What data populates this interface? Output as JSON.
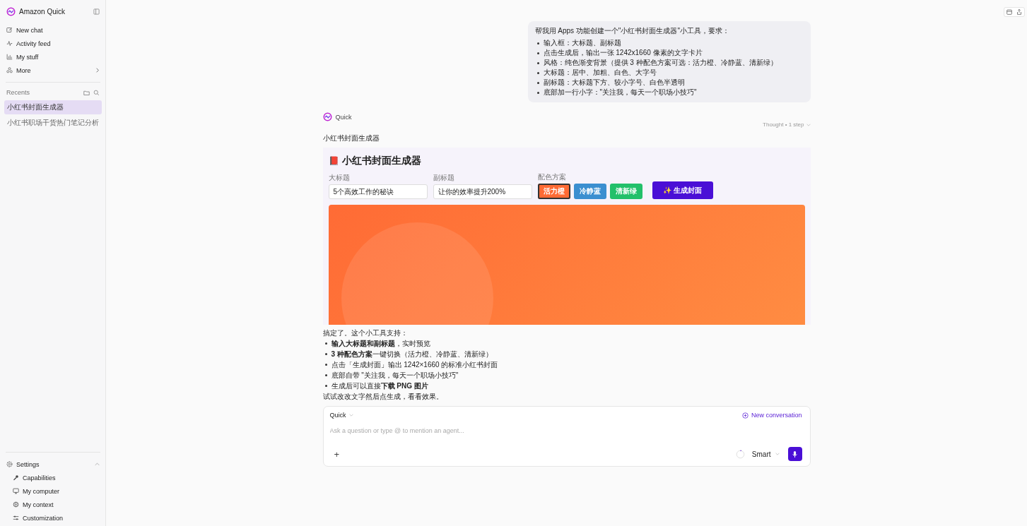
{
  "sidebar": {
    "brand": "Amazon Quick",
    "nav": [
      {
        "label": "New chat"
      },
      {
        "label": "Activity feed"
      },
      {
        "label": "My stuff"
      },
      {
        "label": "More"
      }
    ],
    "recents_label": "Recents",
    "recents": [
      {
        "label": "小红书封面生成器",
        "selected": true
      },
      {
        "label": "小红书职场干货热门笔记分析",
        "selected": false
      }
    ],
    "settings": {
      "label": "Settings",
      "expanded": true,
      "items": [
        {
          "label": "Capabilities"
        },
        {
          "label": "My computer"
        },
        {
          "label": "My context"
        },
        {
          "label": "Customization"
        }
      ]
    }
  },
  "user_message": {
    "intro": "帮我用 Apps 功能创建一个\"小红书封面生成器\"小工具，要求：",
    "bullets": [
      "输入框：大标题、副标题",
      "点击生成后，输出一张 1242x1660 像素的文字卡片",
      "风格：纯色渐变背景（提供 3 种配色方案可选：活力橙、冷静蓝、清新绿）",
      "大标题：居中、加粗、白色、大字号",
      "副标题：大标题下方、较小字号、白色半透明",
      "底部加一行小字：\"关注我，每天一个职场小技巧\""
    ]
  },
  "assistant": {
    "name": "Quick",
    "thought": "Thought • 1 step",
    "app_label": "小红书封面生成器",
    "app": {
      "icon": "📕",
      "title": "小红书封面生成器",
      "fields": [
        {
          "label": "大标题",
          "value": "5个高效工作的秘诀"
        },
        {
          "label": "副标题",
          "value": "让你的效率提升200%"
        }
      ],
      "scheme_label": "配色方案",
      "schemes": [
        {
          "label": "活力橙",
          "color": "#ff6b35",
          "selected": true
        },
        {
          "label": "冷静蓝",
          "color": "#3b8fd0",
          "selected": false
        },
        {
          "label": "清新绿",
          "color": "#22c06a",
          "selected": false
        }
      ],
      "generate": "✨ 生成封面"
    },
    "reply_intro": "搞定了。这个小工具支持：",
    "reply_bullets": [
      "**输入大标题和副标题**，实时预览",
      "**3 种配色方案**一键切换（活力橙、冷静蓝、清新绿）",
      "点击「生成封面」输出 1242×1660 的标准小红书封面",
      "底部自带 \"关注我，每天一个职场小技巧\"",
      "生成后可以直接**下载 PNG 图片**"
    ],
    "reply_outro": "试试改改文字然后点生成，看看效果。"
  },
  "composer": {
    "agent": "Quick",
    "new_conversation": "New conversation",
    "placeholder": "Ask a question or type @ to mention an agent...",
    "mode": "Smart",
    "plus": "+"
  }
}
